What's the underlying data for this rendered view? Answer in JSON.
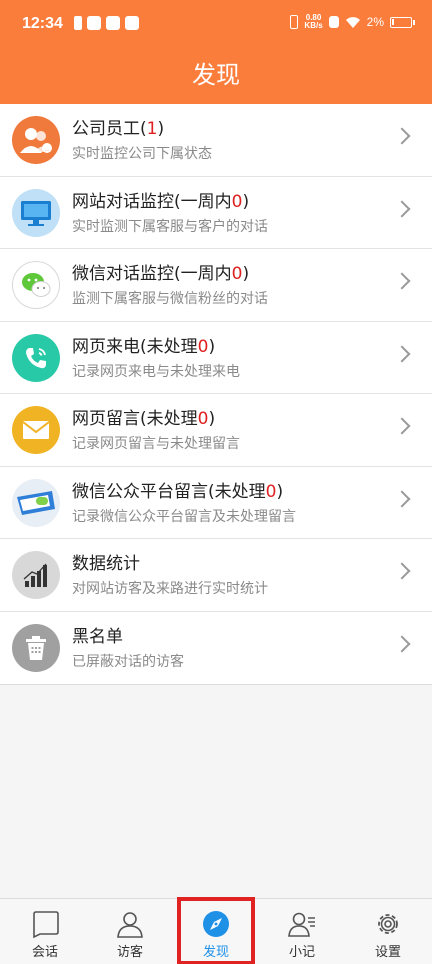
{
  "status_bar": {
    "time": "12:34",
    "net_speed_value": "0.80",
    "net_speed_unit": "KB/s",
    "battery": "2%"
  },
  "header": {
    "title": "发现"
  },
  "items": [
    {
      "title": "公司员工(",
      "count": "1",
      "suffix": ")",
      "subtitle": "实时监控公司下属状态",
      "icon": "staff-icon",
      "color": "#f07a3c"
    },
    {
      "title": "网站对话监控(一周内",
      "count": "0",
      "suffix": ")",
      "subtitle": "实时监测下属客服与客户的对话",
      "icon": "monitor-icon",
      "color": "#bfe0f7"
    },
    {
      "title": "微信对话监控(一周内",
      "count": "0",
      "suffix": ")",
      "subtitle": "监测下属客服与微信粉丝的对话",
      "icon": "wechat-icon",
      "color": "#ffffff"
    },
    {
      "title": "网页来电(未处理",
      "count": "0",
      "suffix": ")",
      "subtitle": "记录网页来电与未处理来电",
      "icon": "phone-icon",
      "color": "#27c9a6"
    },
    {
      "title": "网页留言(未处理",
      "count": "0",
      "suffix": ")",
      "subtitle": "记录网页留言与未处理留言",
      "icon": "mail-icon",
      "color": "#f0b323"
    },
    {
      "title": "微信公众平台留言(未处理",
      "count": "0",
      "suffix": ")",
      "subtitle": "记录微信公众平台留言及未处理留言",
      "icon": "public-account-icon",
      "color": "#e8eef5"
    },
    {
      "title": "数据统计",
      "count": "",
      "suffix": "",
      "subtitle": "对网站访客及来路进行实时统计",
      "icon": "statistics-icon",
      "color": "#d8d8d8"
    },
    {
      "title": "黑名单",
      "count": "",
      "suffix": "",
      "subtitle": "已屏蔽对话的访客",
      "icon": "blacklist-icon",
      "color": "#a0a0a0"
    }
  ],
  "tabs": [
    {
      "label": "会话",
      "icon": "chat-icon"
    },
    {
      "label": "访客",
      "icon": "visitor-icon"
    },
    {
      "label": "发现",
      "icon": "compass-icon",
      "active": true
    },
    {
      "label": "小记",
      "icon": "notes-icon"
    },
    {
      "label": "设置",
      "icon": "settings-icon"
    }
  ],
  "colors": {
    "header": "#fa7d3c",
    "active_tab": "#1e90e6",
    "count": "#e02020"
  }
}
